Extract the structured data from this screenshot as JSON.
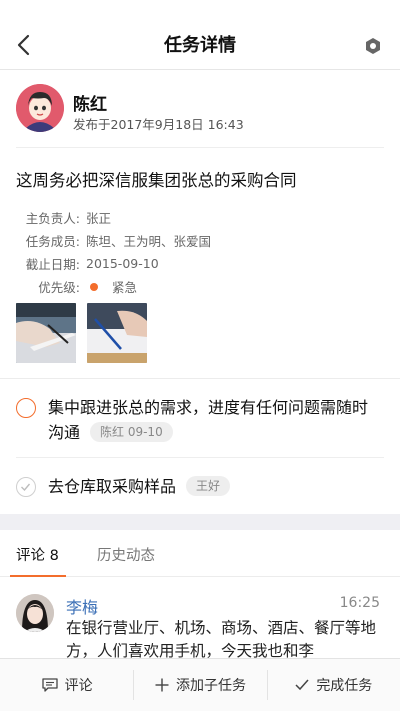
{
  "header": {
    "title": "任务详情",
    "back_icon": "chevron-left-icon",
    "settings_icon": "settings-icon"
  },
  "author": {
    "name": "陈红",
    "published": "发布于2017年9月18日 16:43"
  },
  "task": {
    "title": "这周务必把深信服集团张总的采购合同",
    "fields": [
      {
        "label": "主负责人:",
        "value": "张正"
      },
      {
        "label": "任务成员:",
        "value": "陈坦、王为明、张爱国"
      },
      {
        "label": "截止日期:",
        "value": "2015-09-10"
      },
      {
        "label": "优先级:",
        "value": "紧急",
        "color": "#f36d2c"
      }
    ]
  },
  "subtasks": [
    {
      "text": "集中跟进张总的需求，进度有任何问题需随时沟通",
      "tag": "陈红 09-10",
      "done": false
    },
    {
      "text": "去仓库取采购样品",
      "tag": "王好",
      "done": true
    }
  ],
  "tabs": [
    {
      "label": "评论 8",
      "active": true
    },
    {
      "label": "历史动态",
      "active": false
    }
  ],
  "comment": {
    "name": "李梅",
    "time": "16:25",
    "text": "在银行营业厅、机场、商场、酒店、餐厅等地方，人们喜欢用手机，今天我也和李"
  },
  "bottom_bar": [
    {
      "label": "评论",
      "icon": "comment-icon"
    },
    {
      "label": "添加子任务",
      "icon": "plus-icon"
    },
    {
      "label": "完成任务",
      "icon": "check-icon"
    }
  ],
  "colors": {
    "accent": "#f36d2c",
    "link": "#3b6fb6"
  }
}
